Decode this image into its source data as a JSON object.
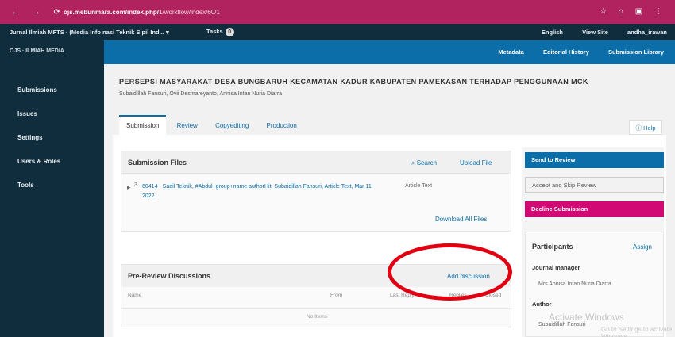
{
  "browser": {
    "url": "ojs.mebunmara.com/index.php/",
    "path": "1/workflow/index/60/1"
  },
  "ojs": {
    "context": "Jurnal Ilmiah MFTS · (Media Info nasi Teknik Sipil Ind...",
    "context_arrow": "▾",
    "tasks": "Tasks",
    "task_count": "0",
    "lang": "English",
    "view_site": "View Site",
    "user": "andha_irawan"
  },
  "sidebar": {
    "logo": "OJS · ILMIAH MEDIA",
    "items": [
      "Submissions",
      "Issues",
      "Settings",
      "Users & Roles",
      "Tools"
    ]
  },
  "topnav": [
    "Metadata",
    "Editorial History",
    "Submission Library"
  ],
  "submission": {
    "title": "PERSEPSI MASYARAKAT DESA BUNGBARUH KECAMATAN KADUR KABUPATEN PAMEKASAN TERHADAP PENGGUNAAN MCK",
    "authors": "Subaidillah Fansuri, Ovii Desmareyanto, Annisa Intan Nuria Diarra"
  },
  "tabs": [
    "Submission",
    "Review",
    "Copyediting",
    "Production"
  ],
  "help": "Help",
  "files": {
    "title": "Submission Files",
    "search": "Search",
    "upload": "Upload File",
    "row": {
      "id": "3",
      "name": "60414 - Sadil Teknik, #Abdul+group+name authorHit, Subaidillah Fansuri, Article Text, Mar 11, 2022",
      "type": "Article Text"
    },
    "download": "Download All Files"
  },
  "discussions": {
    "title": "Pre-Review Discussions",
    "add": "Add discussion",
    "columns": [
      "Name",
      "From",
      "Last Reply",
      "Replies",
      "Closed"
    ],
    "empty": "No Items"
  },
  "actions": {
    "send": "Send to Review",
    "accept": "Accept and Skip Review",
    "decline": "Decline Submission"
  },
  "participants": {
    "title": "Participants",
    "assign": "Assign",
    "groups": [
      {
        "role": "Journal manager",
        "people": [
          "Mrs Annisa Intan Nuria Diarra"
        ]
      },
      {
        "role": "Author",
        "people": [
          "Subaidillah Fansuri"
        ]
      }
    ]
  },
  "watermark": {
    "line1": "Activate Windows",
    "line2": "Go to Settings to activate Windows."
  },
  "colors": {
    "brand": "#0b6ea8",
    "decline": "#d00974",
    "browser": "#b0235f",
    "annotation": "#e00012"
  }
}
